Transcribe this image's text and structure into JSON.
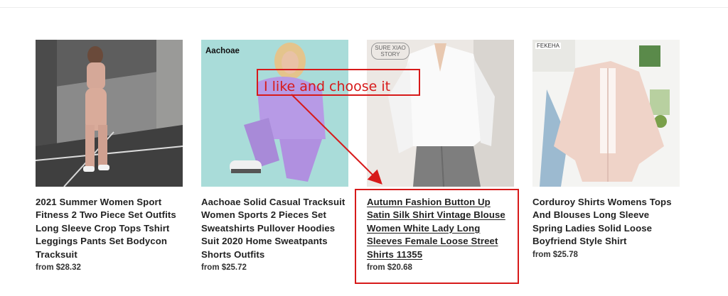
{
  "products": [
    {
      "title": "2021 Summer Women Sport Fitness 2 Two Piece Set Outfits Long Sleeve Crop Tops Tshirt Leggings Pants Set Bodycon Tracksuit",
      "price": "from $28.32",
      "image_icon": "photo-woman-beige-tracksuit"
    },
    {
      "title": "Aachoae Solid Casual Tracksuit Women Sports 2 Pieces Set Sweatshirts Pullover Hoodies Suit 2020 Home Sweatpants Shorts Outfits",
      "price": "from $25.72",
      "image_icon": "photo-woman-lavender-tracksuit",
      "brand": "Aachoae"
    },
    {
      "title": "Autumn Fashion Button Up Satin Silk Shirt Vintage Blouse Women White Lady Long Sleeves Female Loose Street Shirts 11355",
      "price": "from $20.68",
      "image_icon": "photo-white-satin-shirt",
      "brand": "SURE XIAO STORY"
    },
    {
      "title": "Corduroy Shirts Womens Tops And Blouses Long Sleeve Spring Ladies Solid Loose Boyfriend Style Shirt",
      "price": "from $25.78",
      "image_icon": "photo-pink-corduroy-shirt",
      "brand": "FEKEHA"
    }
  ],
  "annotation": {
    "note": "I like and choose it",
    "color": "#d71a1a"
  }
}
